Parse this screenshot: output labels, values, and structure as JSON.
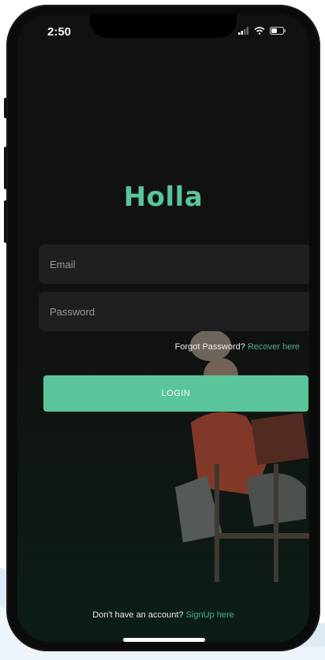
{
  "status_bar": {
    "time": "2:50",
    "signal_icon": "signal-icon",
    "wifi_icon": "wifi-icon",
    "battery_icon": "battery-icon"
  },
  "app": {
    "logo": "Holla",
    "brand_color": "#5ac49a"
  },
  "form": {
    "email": {
      "placeholder": "Email",
      "value": ""
    },
    "password": {
      "placeholder": "Password",
      "value": ""
    }
  },
  "forgot": {
    "question": "Forgot Password?",
    "link": "Recover here"
  },
  "login": {
    "label": "LOGIN"
  },
  "signup": {
    "question": "Don't have an account?",
    "link": "SignUp here"
  }
}
